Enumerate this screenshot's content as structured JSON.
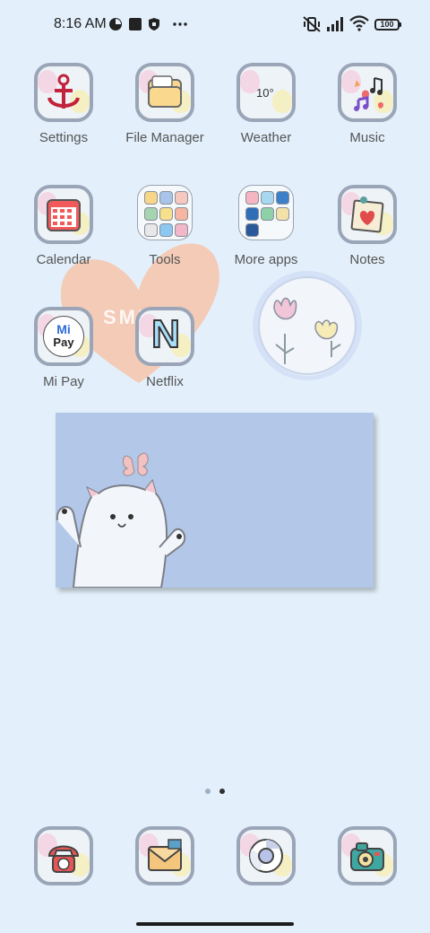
{
  "status_bar": {
    "time": "8:16 AM",
    "battery": "100",
    "icons": [
      "vpn-circle-icon",
      "square-notification-icon",
      "shield-icon",
      "more-dots-icon",
      "mute-vibrate-icon",
      "signal-icon",
      "wifi-icon",
      "battery-icon"
    ]
  },
  "apps": [
    {
      "name": "Settings",
      "icon": "anchor-icon"
    },
    {
      "name": "File Manager",
      "icon": "folder-icon"
    },
    {
      "name": "Weather",
      "icon": "weather-icon",
      "temp": "10°"
    },
    {
      "name": "Music",
      "icon": "music-notes-icon"
    },
    {
      "name": "Calendar",
      "icon": "calendar-icon"
    },
    {
      "name": "Tools",
      "icon": "folder-grid-icon"
    },
    {
      "name": "More apps",
      "icon": "folder-grid-icon"
    },
    {
      "name": "Notes",
      "icon": "note-heart-icon"
    },
    {
      "name": "Mi Pay",
      "icon": "mi-pay-icon",
      "badge_top": "Mi",
      "badge_bottom": "Pay"
    },
    {
      "name": "Netflix",
      "icon": "netflix-n-icon",
      "badge": "N"
    }
  ],
  "widgets": {
    "heart_text": "SMILE",
    "tulip_widget": "tulip-icon",
    "photo_widget": "cat-butterfly-image"
  },
  "pager": {
    "pages": 2,
    "current": 2
  },
  "dock": [
    {
      "icon": "phone-icon"
    },
    {
      "icon": "envelope-icon"
    },
    {
      "icon": "chrome-icon"
    },
    {
      "icon": "camera-icon"
    }
  ],
  "colors": {
    "background": "#e3f0fb",
    "tile_border": "#9ba5b8",
    "heart": "#f4c8b1",
    "photo_bg": "#b3c7e9"
  }
}
